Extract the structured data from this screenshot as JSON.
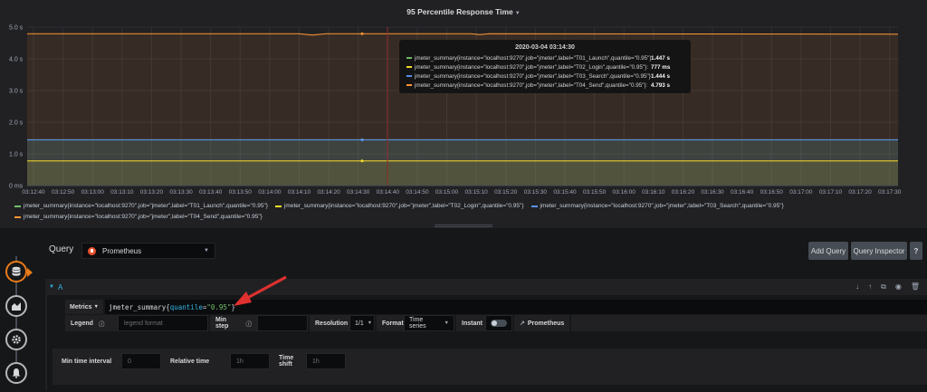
{
  "panel": {
    "title": "95 Percentile Response Time"
  },
  "chart_data": {
    "type": "area",
    "title": "95 Percentile Response Time",
    "y_ticks": [
      "0 ms",
      "1.0 s",
      "2.0 s",
      "3.0 s",
      "4.0 s",
      "5.0 s"
    ],
    "ylim": [
      0,
      5000
    ],
    "y_unit": "ms",
    "x_ticks": [
      "03:12:40",
      "03:12:50",
      "03:13:00",
      "03:13:10",
      "03:13:20",
      "03:13:30",
      "03:13:40",
      "03:13:50",
      "03:14:00",
      "03:14:10",
      "03:14:20",
      "03:14:30",
      "03:14:40",
      "03:14:50",
      "03:15:00",
      "03:15:10",
      "03:15:20",
      "03:15:30",
      "03:15:40",
      "03:15:50",
      "03:16:00",
      "03:16:10",
      "03:16:20",
      "03:16:30",
      "03:16:40",
      "03:16:50",
      "03:17:00",
      "03:17:10",
      "03:17:20",
      "03:17:30"
    ],
    "grid": true,
    "legend_placement": "bottom",
    "hover_x": "03:14:35",
    "series": [
      {
        "name": "jmeter_summary{instance=\"localhost:9270\",job=\"jmeter\",label=\"T01_Launch\",quantile=\"0.95\"}",
        "color": "#73bf69",
        "value": 1447,
        "display": "1.447 s"
      },
      {
        "name": "jmeter_summary{instance=\"localhost:9270\",job=\"jmeter\",label=\"T02_Login\",quantile=\"0.95\"}",
        "color": "#fade2a",
        "value": 777,
        "display": "777 ms"
      },
      {
        "name": "jmeter_summary{instance=\"localhost:9270\",job=\"jmeter\",label=\"T03_Search\",quantile=\"0.95\"}",
        "color": "#5794f2",
        "value": 1444,
        "display": "1.444 s"
      },
      {
        "name": "jmeter_summary{instance=\"localhost:9270\",job=\"jmeter\",label=\"T04_Send\",quantile=\"0.95\"}",
        "color": "#ff9830",
        "value": 4793,
        "display": "4.793 s"
      }
    ]
  },
  "tooltip": {
    "time": "2020-03-04 03:14:30"
  },
  "editor": {
    "query_label": "Query",
    "datasource": "Prometheus",
    "add_query": "Add Query",
    "query_inspector": "Query Inspector",
    "help": "?",
    "query_ref": "A",
    "metrics_label": "Metrics",
    "expr_metric": "jmeter_summary",
    "expr_label_key": "quantile",
    "expr_label_value": "\"0.95\"",
    "legend_label": "Legend",
    "legend_placeholder": "legend format",
    "min_step_label": "Min step",
    "resolution_label": "Resolution",
    "resolution_value": "1/1",
    "format_label": "Format",
    "format_value": "Time series",
    "instant_label": "Instant",
    "prometheus_link": "Prometheus",
    "min_interval_label": "Min time interval",
    "min_interval_placeholder": "0",
    "relative_time_label": "Relative time",
    "relative_time_placeholder": "1h",
    "time_shift_label": "Time shift",
    "time_shift_placeholder": "1h"
  },
  "icons": {
    "sidebar": [
      "database-icon",
      "chart-icon",
      "gear-icon",
      "bell-icon"
    ],
    "row": [
      "move-down-icon",
      "move-up-icon",
      "duplicate-icon",
      "eye-icon",
      "trash-icon"
    ]
  }
}
